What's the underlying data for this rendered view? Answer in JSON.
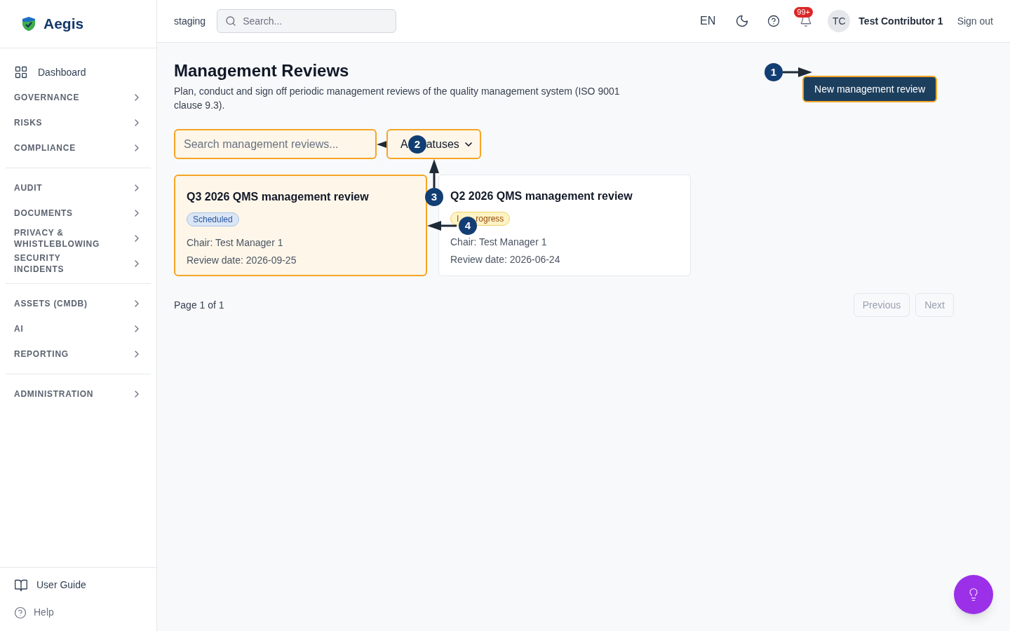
{
  "sidebar": {
    "brand": "Aegis",
    "sections": [
      [
        {
          "kind": "link",
          "label": "Dashboard"
        },
        {
          "kind": "group",
          "label": "GOVERNANCE"
        },
        {
          "kind": "group",
          "label": "RISKS"
        },
        {
          "kind": "group",
          "label": "COMPLIANCE"
        }
      ],
      [
        {
          "kind": "group",
          "label": "AUDIT"
        },
        {
          "kind": "group",
          "label": "DOCUMENTS"
        },
        {
          "kind": "group",
          "label": "PRIVACY & WHISTLEBLOWING"
        },
        {
          "kind": "group",
          "label": "SECURITY INCIDENTS"
        }
      ],
      [
        {
          "kind": "group",
          "label": "ASSETS (CMDB)"
        },
        {
          "kind": "group",
          "label": "AI"
        },
        {
          "kind": "group",
          "label": "REPORTING"
        }
      ],
      [
        {
          "kind": "group",
          "label": "ADMINISTRATION"
        }
      ]
    ],
    "footer": [
      {
        "kind": "guide",
        "label": "User Guide"
      },
      {
        "kind": "help",
        "label": "Help"
      }
    ]
  },
  "header": {
    "environment": "staging",
    "search": {
      "placeholder": "Search..."
    },
    "language": "EN",
    "notifications": "99+",
    "avatar": "TC",
    "user": "Test Contributor 1",
    "sign_out": "Sign out"
  },
  "page": {
    "title": "Management Reviews",
    "description": "Plan, conduct and sign off periodic management reviews of the quality management system (ISO 9001 clause 9.3).",
    "new_button": {
      "label": "New management review",
      "highlighted": true
    },
    "search": {
      "placeholder": "Search management reviews...",
      "highlighted": true
    },
    "status_filter": {
      "value_parts": [
        "A",
        "atuses"
      ],
      "highlighted": true
    },
    "reviews": [
      {
        "title": "Q3 2026 QMS management review",
        "status_parts": [
          "Scheduled"
        ],
        "kind": "scheduled",
        "chair": "Chair: Test Manager 1",
        "date": "Review date: 2026-09-25",
        "highlighted": true
      },
      {
        "title": "Q2 2026 QMS management review",
        "status_parts": [
          "I",
          "rogress"
        ],
        "kind": "in_progress",
        "chair": "Chair: Test Manager 1",
        "date": "Review date: 2026-06-24",
        "highlighted": false
      }
    ],
    "pagination": {
      "label": "Page 1 of 1",
      "previous": {
        "label": "Previous",
        "disabled": true
      },
      "next": {
        "label": "Next",
        "disabled": true
      }
    }
  },
  "annotations": [
    {
      "number": "1"
    },
    {
      "number": "2"
    },
    {
      "number": "3"
    },
    {
      "number": "4"
    }
  ]
}
